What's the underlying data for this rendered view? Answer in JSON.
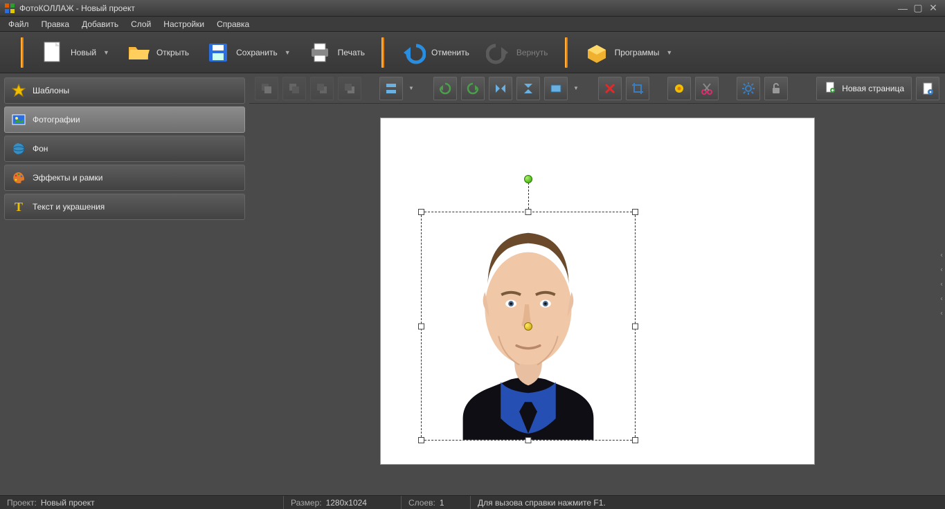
{
  "window": {
    "title": "ФотоКОЛЛАЖ - Новый проект"
  },
  "menu": {
    "file": "Файл",
    "edit": "Правка",
    "add": "Добавить",
    "layer": "Слой",
    "settings": "Настройки",
    "help": "Справка"
  },
  "toolbar": {
    "new": "Новый",
    "open": "Открыть",
    "save": "Сохранить",
    "print": "Печать",
    "undo": "Отменить",
    "redo": "Вернуть",
    "programs": "Программы"
  },
  "sidebar": {
    "templates": "Шаблоны",
    "photos": "Фотографии",
    "background": "Фон",
    "effects": "Эффекты и рамки",
    "text": "Текст и украшения"
  },
  "toolrow": {
    "new_page": "Новая страница"
  },
  "status": {
    "project_label": "Проект:",
    "project_value": "Новый проект",
    "size_label": "Размер:",
    "size_value": "1280x1024",
    "layers_label": "Слоев:",
    "layers_value": "1",
    "hint": "Для вызова справки нажмите F1."
  }
}
